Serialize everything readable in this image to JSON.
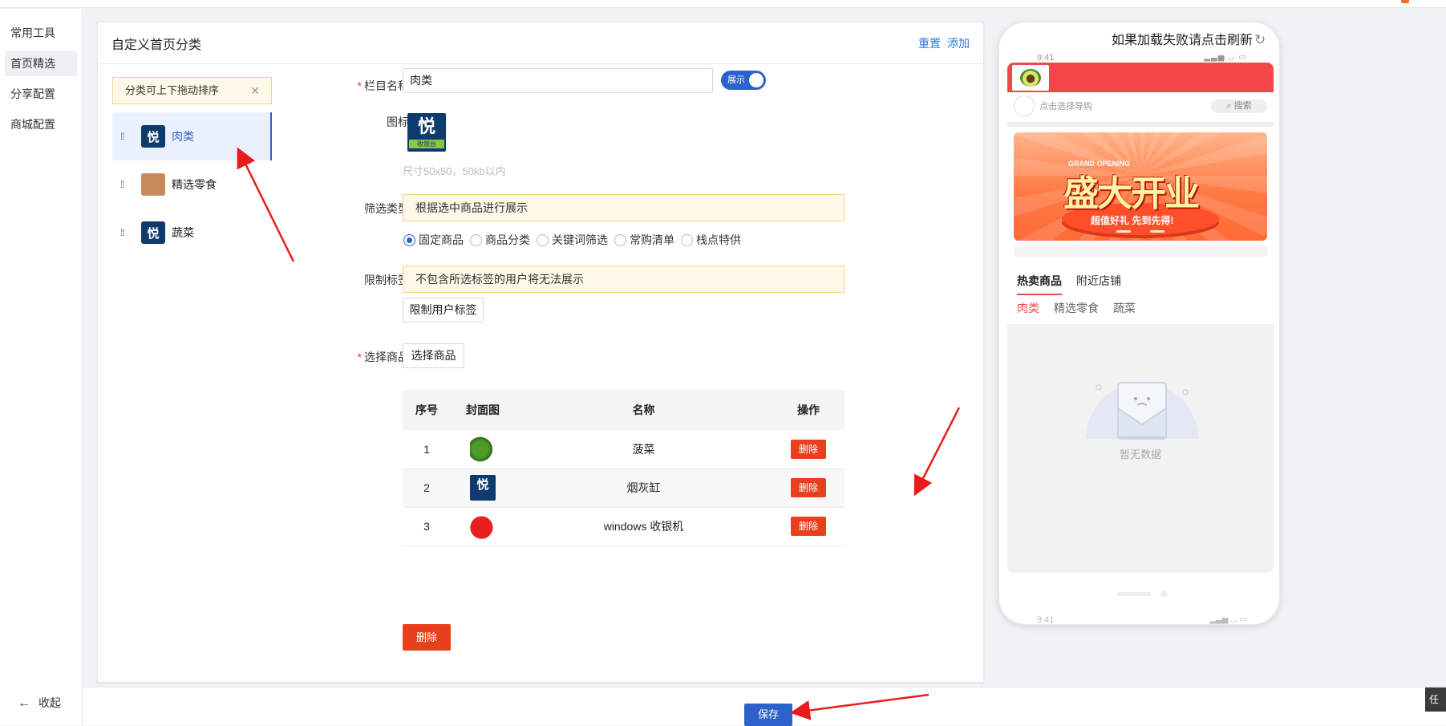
{
  "sidebar": {
    "items": [
      {
        "label": "常用工具"
      },
      {
        "label": "首页精选",
        "active": true
      },
      {
        "label": "分享配置"
      },
      {
        "label": "商城配置"
      }
    ],
    "collapse_label": "收起"
  },
  "panel": {
    "title": "自定义首页分类",
    "actions": {
      "reset": "重置",
      "add": "添加"
    }
  },
  "sort_tip": "分类可上下拖动排序",
  "categories": [
    {
      "label": "肉类",
      "icon": "yue-logo-icon",
      "active": true
    },
    {
      "label": "精选零食",
      "icon": "snack-image-icon"
    },
    {
      "label": "蔬菜",
      "icon": "yue-logo-icon"
    }
  ],
  "form": {
    "name_label": "栏目名称",
    "name_value": "肉类",
    "toggle_label": "展示",
    "icon_label": "图标",
    "icon_text": "悦",
    "icon_sub": "收银台",
    "icon_hint": "尺寸50x50，50kb以内",
    "filter_label": "筛选类型",
    "filter_notice": "根据选中商品进行展示",
    "filter_options": [
      "固定商品",
      "商品分类",
      "关键词筛选",
      "常购清单",
      "栈点特供"
    ],
    "filter_selected": "固定商品",
    "limit_label": "限制标签",
    "limit_notice": "不包含所选标签的用户将无法展示",
    "limit_button": "限制用户标签",
    "goods_label": "选择商品",
    "goods_button": "选择商品"
  },
  "table": {
    "headers": [
      "序号",
      "封面图",
      "名称",
      "操作"
    ],
    "rows": [
      {
        "index": "1",
        "name": "菠菜",
        "cover": "spinach-image",
        "action": "删除"
      },
      {
        "index": "2",
        "name": "烟灰缸",
        "cover": "yue-logo-image",
        "action": "删除"
      },
      {
        "index": "3",
        "name": "windows 收银机",
        "cover": "apple-image",
        "action": "删除"
      }
    ],
    "bulk_delete": "删除"
  },
  "phone": {
    "reload_tip": "如果加载失败请点击刷新",
    "time": "9:41",
    "search_placeholder": "点击选择导购",
    "search_button": "搜索",
    "banner": {
      "top": "GRAND OPENING",
      "title": "盛大开业",
      "sub": "超值好礼 先到先得!"
    },
    "tabs": [
      "热卖商品",
      "附近店铺"
    ],
    "category_tabs": [
      "肉类",
      "精选零食",
      "蔬菜"
    ],
    "empty_text": "暂无数据"
  },
  "footer": {
    "save": "保存",
    "task": "任务"
  },
  "colors": {
    "primary": "#2c62c9",
    "danger": "#e8401c",
    "phone_red": "#f2484a",
    "notice_bg": "#fdf8e7"
  }
}
